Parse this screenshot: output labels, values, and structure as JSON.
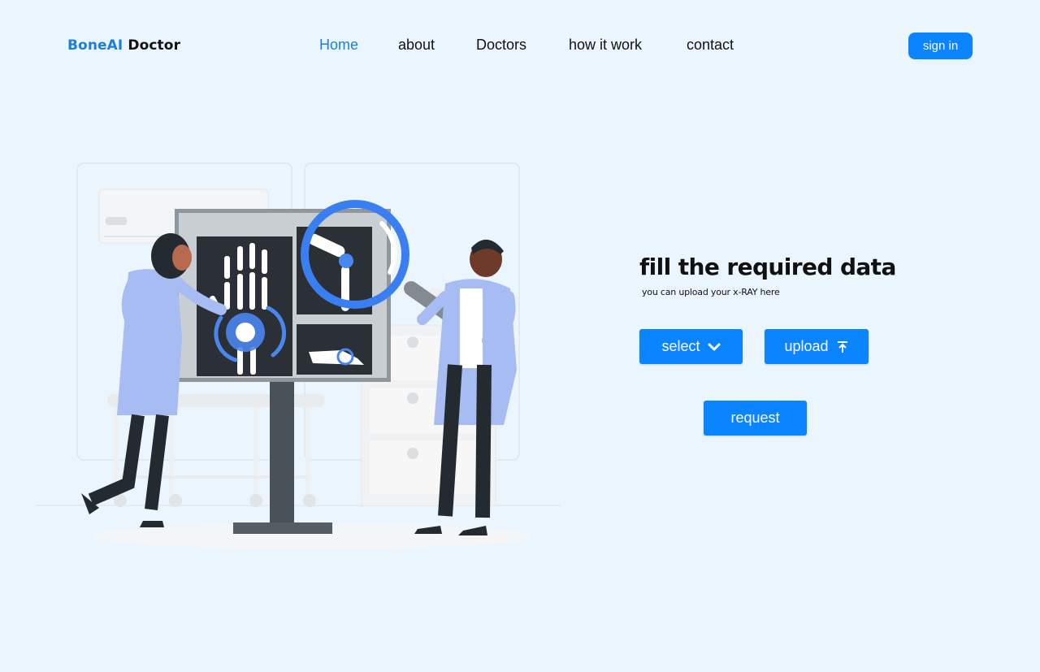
{
  "brand": {
    "part1": "BoneAI",
    "part2": "Doctor"
  },
  "nav": [
    {
      "label": "Home",
      "active": true
    },
    {
      "label": "about",
      "active": false
    },
    {
      "label": "Doctors",
      "active": false
    },
    {
      "label": "how it work",
      "active": false
    },
    {
      "label": "contact",
      "active": false
    }
  ],
  "header": {
    "signin_label": "sign in"
  },
  "form": {
    "title": "fill the required data",
    "subtitle": "you can upload your x-RAY here",
    "select_label": "select",
    "select_icon": "chevron-down-icon",
    "upload_label": "upload",
    "upload_icon": "upload-icon",
    "request_label": "request"
  },
  "colors": {
    "accent": "#0a84ff",
    "brand": "#1a7fe0",
    "background": "#ebf5fd"
  }
}
